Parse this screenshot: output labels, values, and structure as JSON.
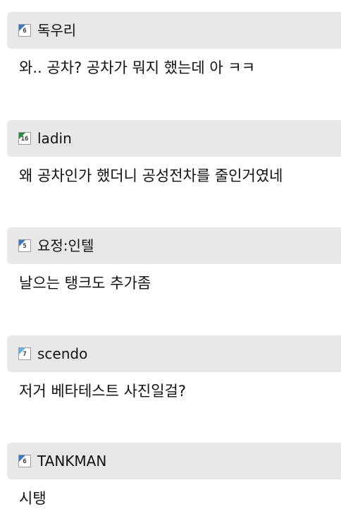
{
  "comments": [
    {
      "username": "독우리",
      "level": "6",
      "level_color": "#3a78c8",
      "text": "와.. 공차? 공차가 뭐지 했는데 아 ㅋㅋ"
    },
    {
      "username": "ladin",
      "level": "16",
      "level_color": "#1f8f3a",
      "text": "왜 공차인가 했더니 공성전차를 줄인거였네"
    },
    {
      "username": "요정:인텔",
      "level": "5",
      "level_color": "#3a78c8",
      "text": "날으는 탱크도 추가좀"
    },
    {
      "username": "scendo",
      "level": "7",
      "level_color": "#5fb6e0",
      "text": "저거 베타테스트 사진일걸?"
    },
    {
      "username": "TANKMAN",
      "level": "6",
      "level_color": "#3a78c8",
      "text": "시탱"
    }
  ]
}
